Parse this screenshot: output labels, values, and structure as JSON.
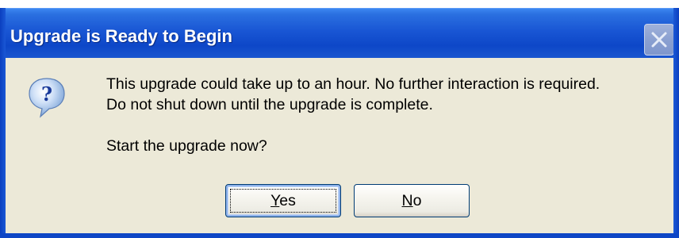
{
  "window": {
    "title": "Upgrade is Ready to Begin"
  },
  "message": {
    "line1": "This upgrade could take up to an hour. No further interaction is required.",
    "line2": "Do not shut down until the upgrade is complete.",
    "line3": "Start the upgrade now?"
  },
  "buttons": {
    "yes": {
      "accel": "Y",
      "rest": "es"
    },
    "no": {
      "accel": "N",
      "rest": "o"
    }
  },
  "icons": {
    "dialog": "question-icon",
    "close": "close-icon"
  },
  "colors": {
    "titlebar": "#0d47c8",
    "body": "#ece9d8",
    "title_text": "#ffffff"
  }
}
